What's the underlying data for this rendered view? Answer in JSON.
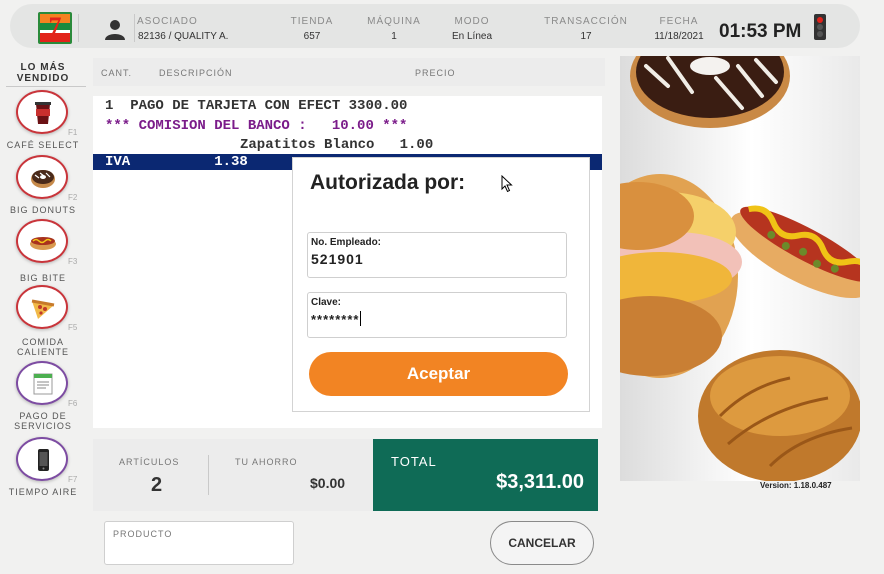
{
  "header": {
    "logo_text": "7-ELEVEN",
    "asociado_label": "ASOCIADO",
    "asociado_value": "82136  / QUALITY A.",
    "tienda_label": "TIENDA",
    "tienda_value": "657",
    "maquina_label": "MÁQUINA",
    "maquina_value": "1",
    "modo_label": "MODO",
    "modo_value": "En Línea",
    "transaccion_label": "TRANSACCIÓN",
    "transaccion_value": "17",
    "fecha_label": "FECHA",
    "fecha_value": "11/18/2021",
    "time": "01:53 PM",
    "status_light": "red"
  },
  "sidebar": {
    "title_line1": "LO MÁS",
    "title_line2": "VENDIDO",
    "items": [
      {
        "label1": "CAFÉ SELECT",
        "label2": "",
        "fkey": "F1",
        "icon": "coffee-cup-icon"
      },
      {
        "label1": "BIG DONUTS",
        "label2": "",
        "fkey": "F2",
        "icon": "donut-icon"
      },
      {
        "label1": "BIG BITE",
        "label2": "",
        "fkey": "F3",
        "icon": "hotdog-icon"
      },
      {
        "label1": "COMIDA",
        "label2": "CALIENTE",
        "fkey": "F5",
        "icon": "pizza-icon"
      },
      {
        "label1": "PAGO DE",
        "label2": "SERVICIOS",
        "fkey": "F6",
        "icon": "receipt-icon"
      },
      {
        "label1": "TIEMPO AIRE",
        "label2": "",
        "fkey": "F7",
        "icon": "phone-icon"
      }
    ]
  },
  "table": {
    "col_cant": "CANT.",
    "col_desc": "DESCRIPCIÓN",
    "col_precio": "PRECIO"
  },
  "receipt": {
    "line1": "1  PAGO DE TARJETA CON EFECT 3300.00",
    "line2": "*** COMISION DEL BANCO :   10.00 ***",
    "line3": "Zapatitos Blanco   1.00",
    "line4": "IVA          1.38"
  },
  "modal": {
    "title": "Autorizada por:",
    "employee_label": "No. Empleado:",
    "employee_value": "521901",
    "password_label": "Clave:",
    "password_value": "********",
    "accept_label": "Aceptar"
  },
  "totals": {
    "articulos_label": "ARTÍCULOS",
    "articulos_value": "2",
    "ahorro_label": "TU AHORRO",
    "ahorro_value": "$0.00",
    "total_label": "TOTAL",
    "total_value": "$3,311.00"
  },
  "bottom": {
    "product_label": "PRODUCTO",
    "cancel_label": "CANCELAR"
  },
  "version": "Version: 1.18.0.487",
  "colors": {
    "total_bg": "#0f6b56",
    "accept_bg": "#f28423",
    "receipt_highlight": "#0b2872",
    "receipt_purple": "#7b1c8a"
  }
}
